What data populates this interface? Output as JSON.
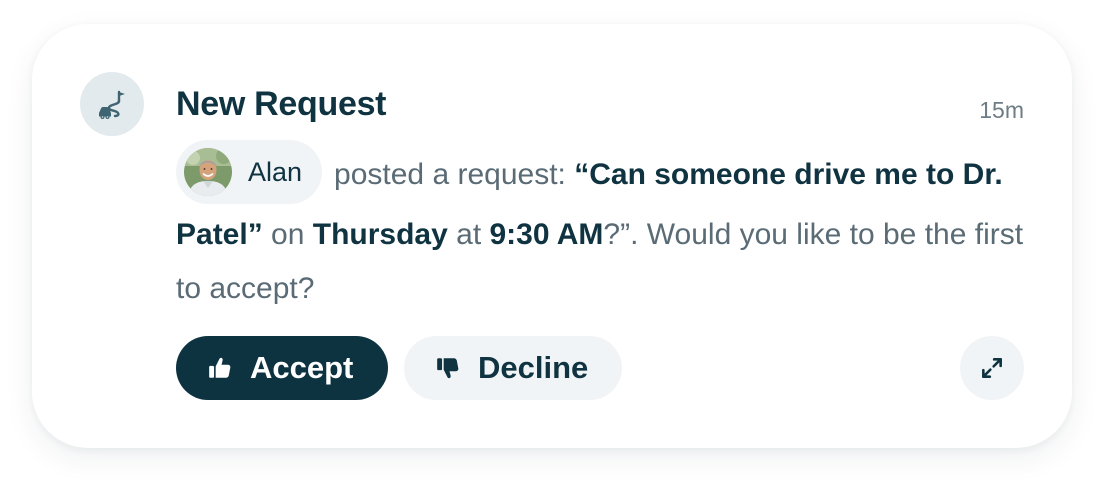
{
  "notification": {
    "title": "New Request",
    "timestamp": "15m",
    "type_icon": "car-route-icon",
    "requester": {
      "name": "Alan",
      "avatar_icon": "user-photo"
    },
    "message": {
      "part1": "posted a request: ",
      "request_text": "“Can someone drive me to Dr. Patel”",
      "part2": " on ",
      "day": "Thursday",
      "part3": " at ",
      "time": "9:30 AM",
      "part4": "?”. Would you like to be the first to accept?"
    },
    "actions": {
      "accept_label": "Accept",
      "accept_icon": "thumbs-up-icon",
      "decline_label": "Decline",
      "decline_icon": "thumbs-down-icon",
      "expand_icon": "expand-icon"
    }
  },
  "colors": {
    "primary": "#0d3340",
    "text_muted": "#5a6b75",
    "chip_bg": "#f1f4f6",
    "icon_bg": "#e2eaed"
  }
}
